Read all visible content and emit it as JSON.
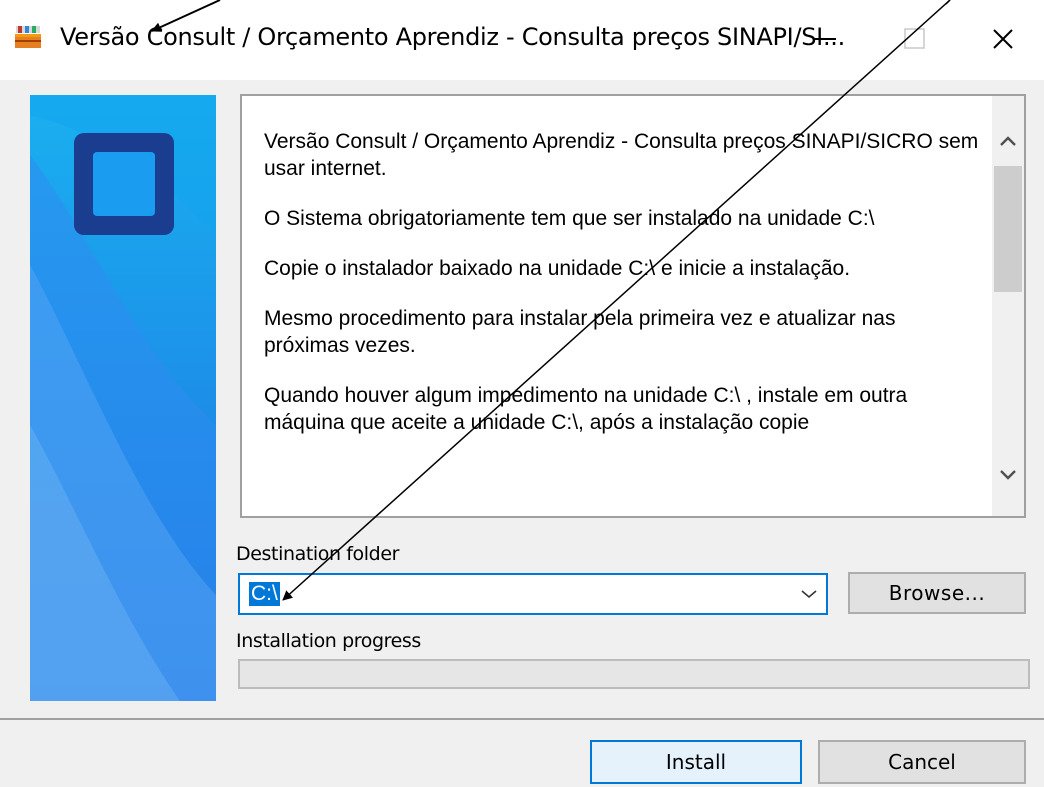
{
  "window": {
    "title": "Versão Consult / Orçamento Aprendiz - Consulta preços SINAPI/SI...",
    "min_icon": "minimize-icon",
    "max_icon": "maximize-icon",
    "close_icon": "close-icon"
  },
  "info": {
    "paragraphs": [
      "Versão Consult / Orçamento Aprendiz - Consulta preços SINAPI/SICRO sem usar internet.",
      "O Sistema obrigatoriamente tem que ser instalado na unidade C:\\",
      "Copie o instalador baixado na unidade C:\\ e inicie a instalação.",
      "Mesmo procedimento para instalar pela primeira vez e atualizar nas próximas vezes.",
      "Quando houver algum impedimento na unidade C:\\  , instale em outra máquina que aceite a unidade C:\\, após a instalação copie"
    ]
  },
  "destination": {
    "label": "Destination folder",
    "value": "C:\\",
    "browse_label": "Browse..."
  },
  "progress": {
    "label": "Installation progress",
    "value": 0
  },
  "buttons": {
    "install": "Install",
    "cancel": "Cancel"
  },
  "colors": {
    "accent": "#0078d7",
    "banner_blue": "#1e88e5",
    "logo_dark": "#1b3d8f"
  }
}
